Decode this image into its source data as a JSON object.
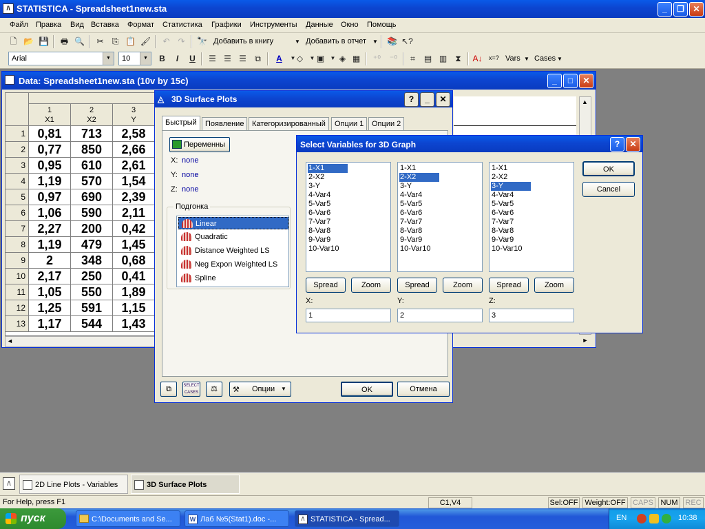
{
  "app": {
    "title": "STATISTICA - Spreadsheet1new.sta"
  },
  "menu": [
    "Файл",
    "Правка",
    "Вид",
    "Вставка",
    "Формат",
    "Статистика",
    "Графики",
    "Инструменты",
    "Данные",
    "Окно",
    "Помощь"
  ],
  "toolbar1": {
    "add_to_book": "Добавить в книгу",
    "add_to_report": "Добавить в отчет"
  },
  "toolbar2": {
    "font": "Arial",
    "size": "10",
    "bold": "B",
    "italic": "I",
    "underline": "U",
    "vars": "Vars",
    "cases": "Cases",
    "xeq": "x=?"
  },
  "spreadsheet": {
    "title": "Data: Spreadsheet1new.sta (10v by 15c)",
    "columns": [
      {
        "num": "1",
        "name": "X1"
      },
      {
        "num": "2",
        "name": "X2"
      },
      {
        "num": "3",
        "name": "Y"
      }
    ],
    "rows": [
      {
        "n": "1",
        "v": [
          "0,81",
          "713",
          "2,58"
        ]
      },
      {
        "n": "2",
        "v": [
          "0,77",
          "850",
          "2,66"
        ]
      },
      {
        "n": "3",
        "v": [
          "0,95",
          "610",
          "2,61"
        ]
      },
      {
        "n": "4",
        "v": [
          "1,19",
          "570",
          "1,54"
        ]
      },
      {
        "n": "5",
        "v": [
          "0,97",
          "690",
          "2,39"
        ]
      },
      {
        "n": "6",
        "v": [
          "1,06",
          "590",
          "2,11"
        ]
      },
      {
        "n": "7",
        "v": [
          "2,27",
          "200",
          "0,42"
        ]
      },
      {
        "n": "8",
        "v": [
          "1,19",
          "479",
          "1,45"
        ]
      },
      {
        "n": "9",
        "v": [
          "2",
          "348",
          "0,68"
        ]
      },
      {
        "n": "10",
        "v": [
          "2,17",
          "250",
          "0,41"
        ]
      },
      {
        "n": "11",
        "v": [
          "1,05",
          "550",
          "1,89"
        ]
      },
      {
        "n": "12",
        "v": [
          "1,25",
          "591",
          "1,15"
        ]
      },
      {
        "n": "13",
        "v": [
          "1,17",
          "544",
          "1,43"
        ]
      }
    ]
  },
  "surface_dialog": {
    "title": "3D Surface Plots",
    "help": "?",
    "tabs": [
      "Быстрый",
      "Появление",
      "Категоризированный",
      "Опции 1",
      "Опции 2"
    ],
    "variables_button": "Переменны",
    "x_label": "X:",
    "x_value": "none",
    "y_label": "Y:",
    "y_value": "none",
    "z_label": "Z:",
    "z_value": "none",
    "fit_group": "Подгонка",
    "fits": [
      "Linear",
      "Quadratic",
      "Distance Weighted LS",
      "Neg Expon Weighted LS",
      "Spline"
    ],
    "select_cases": "SELECT CASES",
    "options_button": "Опции",
    "ok": "OK",
    "cancel": "Отмена"
  },
  "select_dialog": {
    "title": "Select Variables for 3D Graph",
    "help": "?",
    "variables": [
      "1-X1",
      "2-X2",
      "3-Y",
      "4-Var4",
      "5-Var5",
      "6-Var6",
      "7-Var7",
      "8-Var8",
      "9-Var9",
      "10-Var10"
    ],
    "spread": "Spread",
    "zoom": "Zoom",
    "x_label": "X:",
    "x_value": "1",
    "y_label": "Y:",
    "y_value": "2",
    "z_label": "Z:",
    "z_value": "3",
    "ok": "OK",
    "cancel": "Cancel"
  },
  "window_tabs": [
    "2D Line Plots - Variables",
    "3D Surface Plots"
  ],
  "status": {
    "help": "For Help, press F1",
    "cell": "C1,V4",
    "sel": "Sel:OFF",
    "weight": "Weight:OFF",
    "caps": "CAPS",
    "num": "NUM",
    "rec": "REC"
  },
  "taskbar": {
    "start": "пуск",
    "tasks": [
      "C:\\Documents and Se...",
      "Лаб №5(Stat1).doc -...",
      "STATISTICA - Spread..."
    ],
    "lang": "EN",
    "time": "10:38"
  }
}
